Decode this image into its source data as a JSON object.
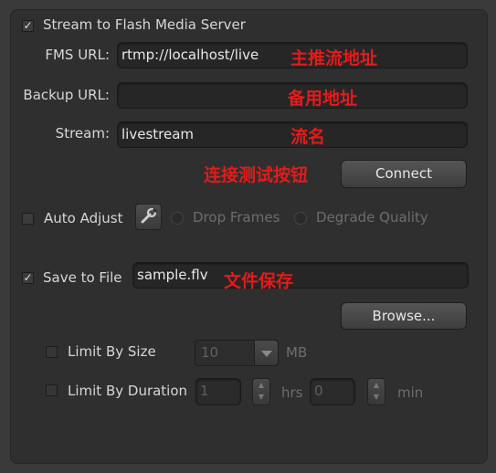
{
  "stream": {
    "checkbox_label": "Stream to Flash Media Server",
    "checked": true,
    "fms_url_label": "FMS URL:",
    "fms_url_value": "rtmp://localhost/live",
    "backup_url_label": "Backup URL:",
    "backup_url_value": "",
    "stream_label": "Stream:",
    "stream_value": "livestream",
    "connect_label": "Connect"
  },
  "annotations": {
    "fms_url": "主推流地址",
    "backup_url": "备用地址",
    "stream_name": "流名",
    "connect": "连接测试按钮",
    "save_file": "文件保存"
  },
  "auto_adjust": {
    "label": "Auto Adjust",
    "checked": false,
    "drop_frames_label": "Drop Frames",
    "degrade_quality_label": "Degrade Quality"
  },
  "save": {
    "label": "Save to File",
    "checked": true,
    "file_value": "sample.flv",
    "browse_label": "Browse..."
  },
  "limit_size": {
    "label": "Limit By Size",
    "value": "10",
    "unit": "MB"
  },
  "limit_duration": {
    "label": "Limit By Duration",
    "hours_value": "1",
    "hours_unit": "hrs",
    "minutes_value": "0",
    "minutes_unit": "min"
  },
  "colors": {
    "annotation": "#e31b1b",
    "panel": "#2f2f2f"
  }
}
